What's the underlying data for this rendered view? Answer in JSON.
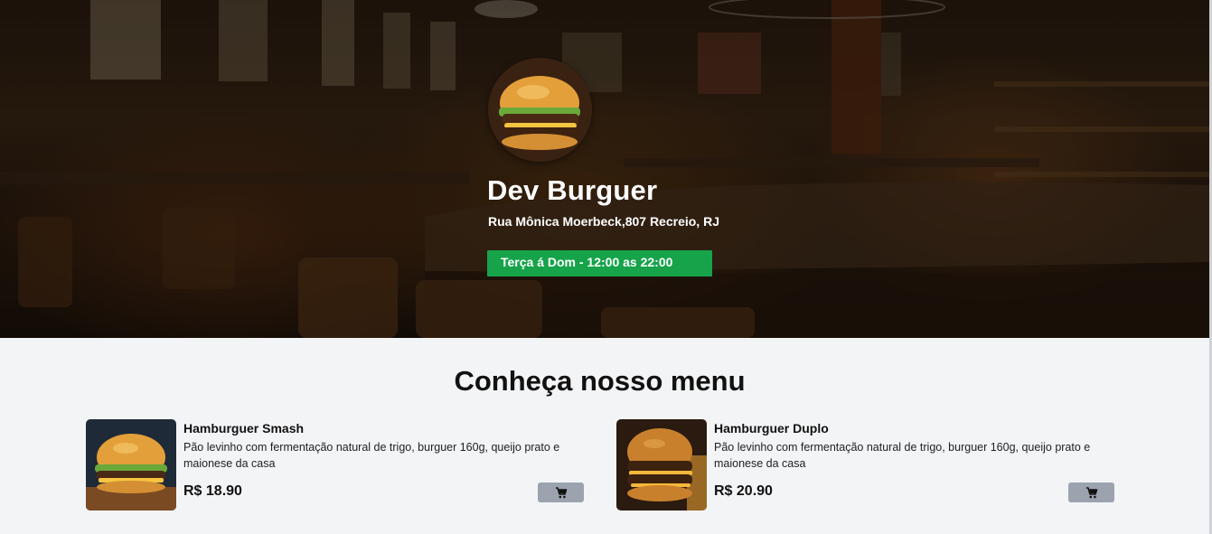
{
  "hero": {
    "title": "Dev Burguer",
    "address": "Rua Mônica Moerbeck,807 Recreio, RJ",
    "hours": "Terça á Dom - 12:00 as 22:00"
  },
  "menu": {
    "title": "Conheça nosso menu",
    "items": [
      {
        "name": "Hamburguer Smash",
        "description": "Pão levinho com fermentação natural de trigo, burguer 160g, queijo prato e maionese da casa",
        "price": "R$ 18.90",
        "cart_icon": "cart-icon"
      },
      {
        "name": "Hamburguer Duplo",
        "description": "Pão levinho com fermentação natural de trigo, burguer 160g, queijo prato e maionese da casa",
        "price": "R$ 20.90",
        "cart_icon": "cart-icon"
      }
    ]
  },
  "colors": {
    "accent_green": "#16a34a",
    "cart_button": "#9ca3af",
    "page_bg": "#f3f4f6"
  }
}
